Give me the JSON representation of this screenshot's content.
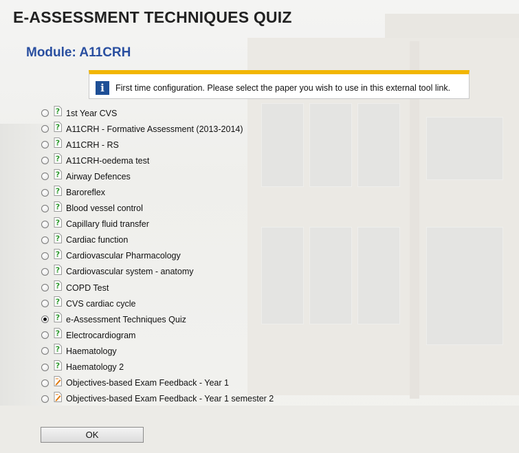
{
  "header": {
    "title": "E-ASSESSMENT TECHNIQUES QUIZ"
  },
  "module": {
    "title": "Module: A11CRH"
  },
  "info_banner": {
    "icon": "info-icon",
    "text": "First time configuration. Please select the paper you wish to use in this external tool link.",
    "accent_color": "#f2b600",
    "icon_color": "#1e4f96"
  },
  "papers": [
    {
      "label": "1st Year CVS",
      "icon": "quiz-question-icon",
      "checked": false
    },
    {
      "label": "A11CRH - Formative Assessment (2013-2014)",
      "icon": "quiz-question-icon",
      "checked": false
    },
    {
      "label": "A11CRH - RS",
      "icon": "quiz-question-icon",
      "checked": false
    },
    {
      "label": "A11CRH-oedema test",
      "icon": "quiz-question-icon",
      "checked": false
    },
    {
      "label": "Airway Defences",
      "icon": "quiz-question-icon",
      "checked": false
    },
    {
      "label": "Baroreflex",
      "icon": "quiz-question-icon",
      "checked": false
    },
    {
      "label": "Blood vessel control",
      "icon": "quiz-question-icon",
      "checked": false
    },
    {
      "label": "Capillary fluid transfer",
      "icon": "quiz-question-icon",
      "checked": false
    },
    {
      "label": "Cardiac function",
      "icon": "quiz-question-icon",
      "checked": false
    },
    {
      "label": "Cardiovascular Pharmacology",
      "icon": "quiz-question-icon",
      "checked": false
    },
    {
      "label": "Cardiovascular system - anatomy",
      "icon": "quiz-question-icon",
      "checked": false
    },
    {
      "label": "COPD Test",
      "icon": "quiz-question-icon",
      "checked": false
    },
    {
      "label": "CVS cardiac cycle",
      "icon": "quiz-question-icon",
      "checked": false
    },
    {
      "label": "e-Assessment Techniques Quiz",
      "icon": "quiz-question-icon",
      "checked": true
    },
    {
      "label": "Electrocardiogram",
      "icon": "quiz-question-icon",
      "checked": false
    },
    {
      "label": "Haematology",
      "icon": "quiz-question-icon",
      "checked": false
    },
    {
      "label": "Haematology 2",
      "icon": "quiz-question-icon",
      "checked": false
    },
    {
      "label": "Objectives-based Exam Feedback - Year 1",
      "icon": "objectives-feedback-icon",
      "checked": false
    },
    {
      "label": "Objectives-based Exam Feedback - Year 1 semester 2",
      "icon": "objectives-feedback-icon",
      "checked": false
    }
  ],
  "actions": {
    "ok_label": "OK"
  },
  "colors": {
    "title": "#222222",
    "module_title": "#2a4fa0",
    "quiz_icon": "#2e9a2e",
    "feedback_icon": "#e07a10"
  }
}
